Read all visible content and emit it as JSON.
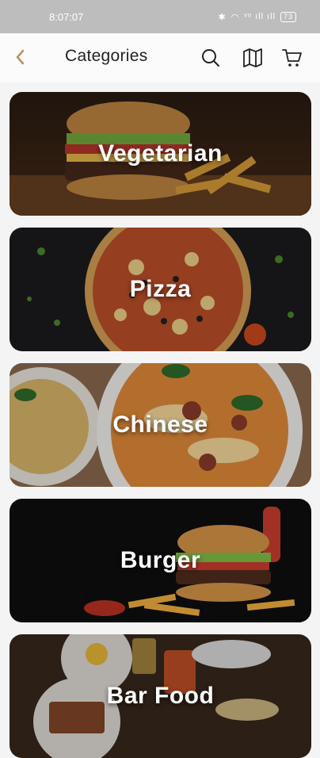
{
  "status_bar": {
    "time": "8:07:07",
    "signal_text": "ᵛᵒ ıll ıll",
    "battery": "73"
  },
  "header": {
    "title": "Categories",
    "back_icon": "chevron-left-icon",
    "search_icon": "search-icon",
    "map_icon": "map-icon",
    "cart_icon": "cart-icon",
    "accent_color": "#b5945b"
  },
  "categories": [
    {
      "label": "Vegetarian"
    },
    {
      "label": "Pizza"
    },
    {
      "label": "Chinese"
    },
    {
      "label": "Burger"
    },
    {
      "label": "Bar Food"
    }
  ]
}
